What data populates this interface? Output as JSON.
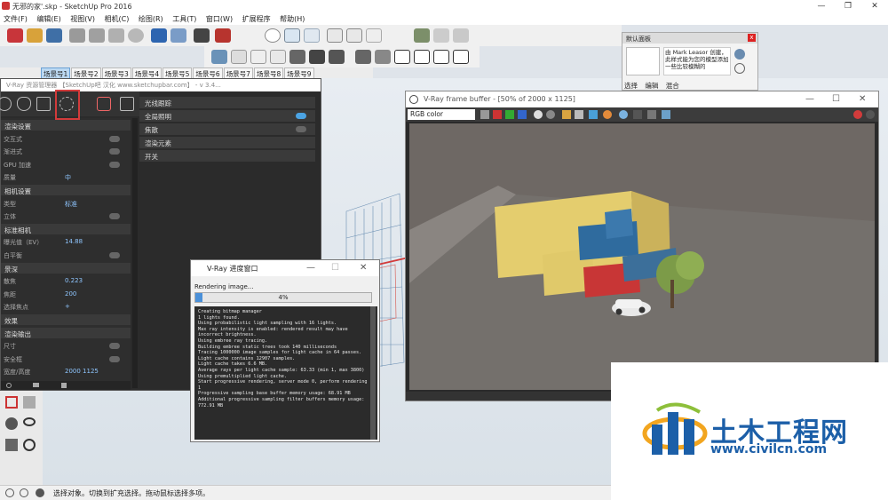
{
  "app": {
    "title": "无邪的家'.skp - SketchUp Pro 2016",
    "window_controls": [
      "—",
      "❐",
      "✕"
    ]
  },
  "menu": [
    "文件(F)",
    "编辑(E)",
    "视图(V)",
    "相机(C)",
    "绘图(R)",
    "工具(T)",
    "窗口(W)",
    "扩展程序",
    "帮助(H)"
  ],
  "scene_tabs": [
    "场景号1",
    "场景号2",
    "场景号3",
    "场景号4",
    "场景号5",
    "场景号6",
    "场景号7",
    "场景号8",
    "场景号9"
  ],
  "tray": {
    "title": "默认面板",
    "close": "x",
    "text": "由 Mark Leasor 创建，此样式能为您的模型添加一些比较模糊的",
    "tabs": [
      "选择",
      "编辑",
      "混合"
    ]
  },
  "asset_editor": {
    "title": "V-Ray 资源管理器 【SketchUp吧 汉化 www.sketchupbar.com】 - v 3.4...",
    "left_rows": [
      {
        "type": "sec",
        "label": "渲染设置"
      },
      {
        "type": "row",
        "label": "交互式",
        "value": ""
      },
      {
        "type": "row",
        "label": "渐进式",
        "value": ""
      },
      {
        "type": "row",
        "label": "GPU 加速",
        "value": ""
      },
      {
        "type": "row",
        "label": "质量",
        "value": "中"
      },
      {
        "type": "sec",
        "label": "相机设置"
      },
      {
        "type": "row",
        "label": "类型",
        "value": "标准"
      },
      {
        "type": "row",
        "label": "立体",
        "value": ""
      },
      {
        "type": "sec",
        "label": "标准相机"
      },
      {
        "type": "row",
        "label": "曝光值（EV）",
        "value": "14.88"
      },
      {
        "type": "row",
        "label": "白平衡",
        "value": ""
      },
      {
        "type": "sec",
        "label": "景深"
      },
      {
        "type": "row",
        "label": "散焦",
        "value": "0.223"
      },
      {
        "type": "row",
        "label": "焦距",
        "value": "200"
      },
      {
        "type": "row",
        "label": "选择焦点",
        "value": "+"
      },
      {
        "type": "sec",
        "label": "效果"
      },
      {
        "type": "sec",
        "label": "渲染输出"
      },
      {
        "type": "row",
        "label": "尺寸",
        "value": ""
      },
      {
        "type": "row",
        "label": "安全框",
        "value": ""
      },
      {
        "type": "row",
        "label": "宽度/高度",
        "value": "2000      1125"
      }
    ],
    "right_rows": [
      "光线跟踪",
      "全局照明",
      "焦散",
      "渲染元素",
      "开关"
    ]
  },
  "frame_buffer": {
    "title": "V-Ray frame buffer - [50% of 2000 x 1125]",
    "channel": "RGB color"
  },
  "progress": {
    "title": "V-Ray 进度窗口",
    "status": "Rendering image...",
    "percent_label": "4%",
    "percent": 0.04,
    "log": [
      "Creating bitmap manager",
      "1 lights found.",
      "Using probabilistic light sampling with 16 lights.",
      "Max ray intensity is enabled: rendered result may have",
      "incorrect brightness.",
      "Using embree ray tracing.",
      "Building embree static trees took 140 milliseconds",
      "Tracing 1000000 image samples for light cache in 64 passes.",
      "Light cache contains 12907 samples.",
      "Light cache takes 6.6 MB.",
      "Average rays per light cache sample: 63.33 (min 1, max 3800)",
      "Using premultiplied light cache.",
      "Start progressive rendering, server mode 0, perform rendering",
      "1",
      "Progressive sampling base buffer memory usage: 68.91 MB",
      "Additional progressive sampling filter buffers memory usage:",
      "772.91 MB"
    ]
  },
  "statusbar": {
    "text": "选择对象。切换到扩充选择。拖动鼠标选择多项。"
  },
  "watermark": {
    "name": "土木工程网",
    "url": "www.civilcn.com"
  },
  "colors": {
    "accent_red": "#d23b3b",
    "vray_blue": "#4ba3e3",
    "progress_fill": "#4a90d9",
    "watermark_blue": "#1c5fa8"
  }
}
